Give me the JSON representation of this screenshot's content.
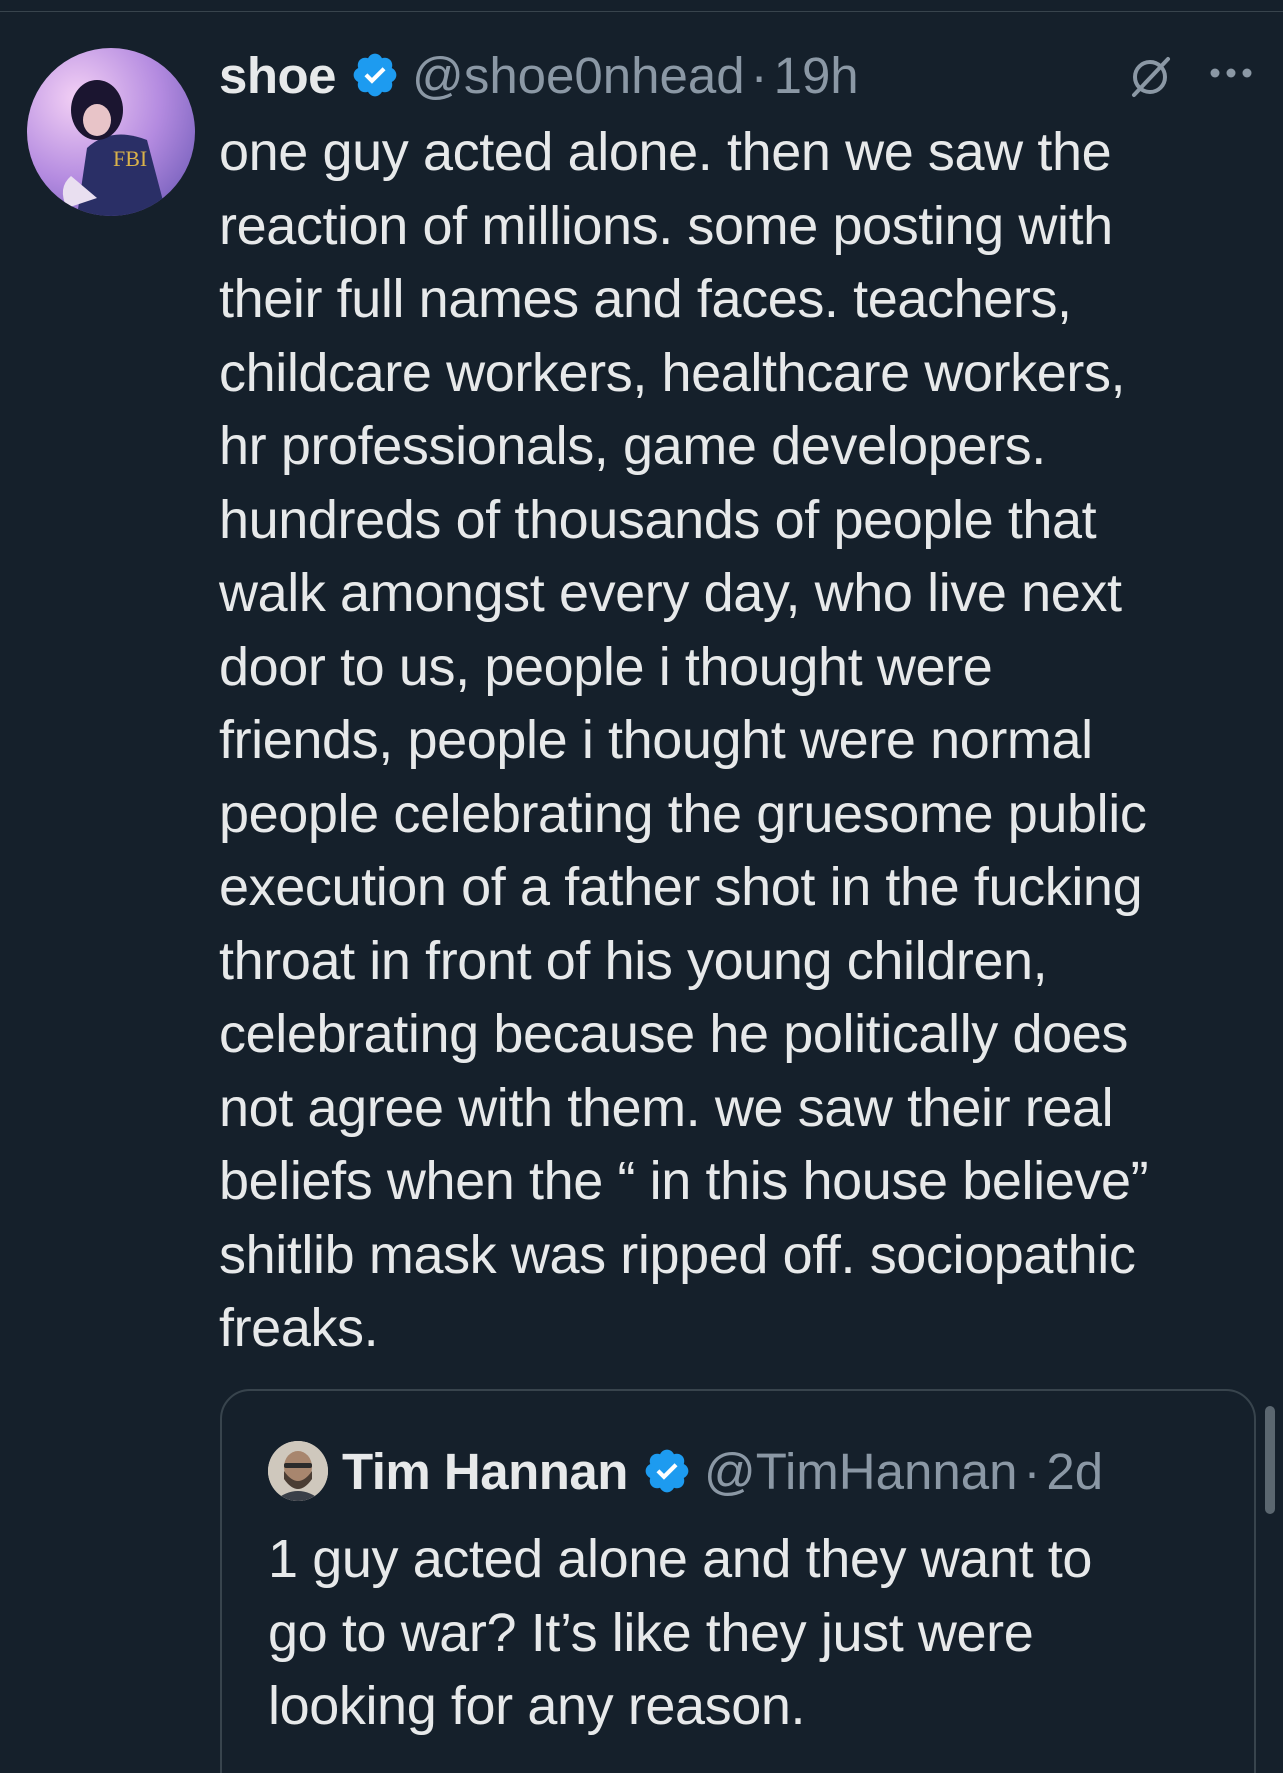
{
  "tweet": {
    "author": {
      "display_name": "shoe",
      "handle": "@shoe0nhead",
      "verified": true,
      "avatar_icon": "user-avatar"
    },
    "separator": "·",
    "time": "19h",
    "text_lines": [
      "one guy acted alone. then we saw the",
      "reaction of millions. some posting with",
      "their full names and faces. teachers,",
      "childcare workers, healthcare workers,",
      "hr professionals, game developers.",
      "hundreds of thousands of people that",
      "walk amongst every day, who live next",
      "door to us, people i thought were",
      "friends, people i thought were normal",
      "people celebrating the gruesome public",
      "execution of a father shot in the fucking",
      "throat in front of his young children,",
      "celebrating because he politically does",
      "not agree with them. we saw their real",
      "beliefs when the “ in this house believe”",
      "shitlib mask was ripped off. sociopathic",
      "freaks."
    ]
  },
  "quoted_tweet": {
    "author": {
      "display_name": "Tim Hannan",
      "handle": "@TimHannan",
      "verified": true,
      "avatar_icon": "user-avatar"
    },
    "separator": "·",
    "time": "2d",
    "text_lines": [
      "1 guy acted alone and they want to",
      "go to war? It’s like they just were",
      "looking for any reason."
    ]
  },
  "icons": {
    "verified": "verified-badge-icon",
    "grok": "grok-icon",
    "more": "more-icon"
  },
  "colors": {
    "background": "#15202b",
    "primary_text": "#e7e9ea",
    "secondary_text": "#8b98a5",
    "verified_blue": "#1d9bf0",
    "border": "#38444d"
  }
}
